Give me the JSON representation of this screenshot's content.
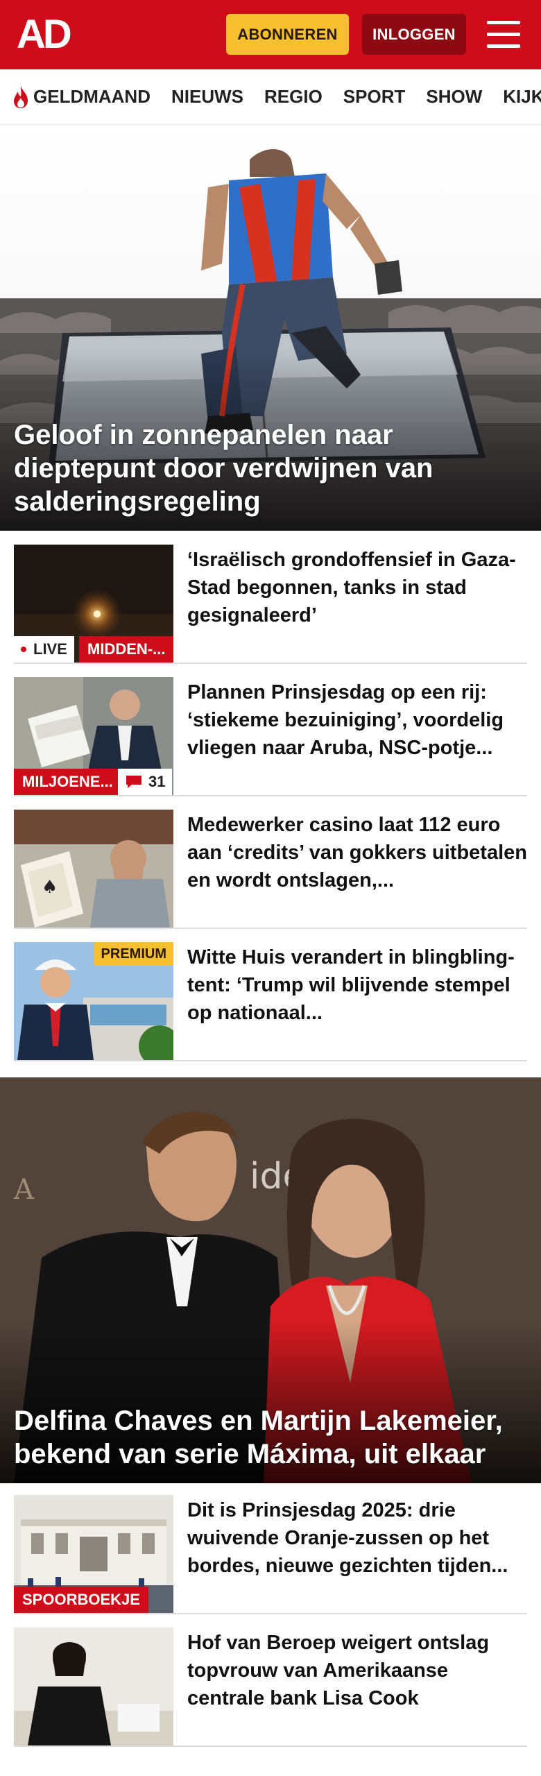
{
  "header": {
    "logo_text": "AD",
    "subscribe_label": "ABONNEREN",
    "login_label": "INLOGGEN",
    "brand_color": "#cf0d1a",
    "accent_color": "#f6c030"
  },
  "nav": {
    "items": [
      "GELDMAAND",
      "NIEUWS",
      "REGIO",
      "SPORT",
      "SHOW",
      "KIJK"
    ],
    "first_item_icon": "flame-icon"
  },
  "hero_top": {
    "headline": "Geloof in zonnepanelen naar dieptepunt door verdwijnen van salderingsregeling",
    "image": "roofer-installing-solar-panels"
  },
  "articles_a": [
    {
      "headline": "‘Israëlisch grondoffensief in Gaza-Stad begonnen, tanks in stad gesignaleerd’",
      "live_label": "LIVE",
      "tag": "MIDDEN-...",
      "image": "night-explosion"
    },
    {
      "headline": "Plannen Prinsjesdag op een rij: ‘stiekeme bezuiniging’, voordelig vliegen naar Aruba, NSC-potje...",
      "tag": "MILJOENE...",
      "comments": "31",
      "image": "minister-with-documents"
    },
    {
      "headline": "Medewerker casino laat 112 euro aan ‘credits’ van gokkers uitbetalen en wordt ontslagen,...",
      "image": "casino-cards-man"
    },
    {
      "headline": "Witte Huis verandert in blingbling-tent: ‘Trump wil blijvende stempel op nationaal...",
      "premium_label": "PREMIUM",
      "image": "trump-hard-hat"
    }
  ],
  "hero_mid": {
    "headline": "Delfina Chaves en Martijn Lakemeier, bekend van serie Máxima, uit elkaar",
    "image": "couple-red-carpet"
  },
  "articles_b": [
    {
      "headline": "Dit is Prinsjesdag 2025: drie wuivende Oranje-zussen op het bordes, nieuwe gezichten tijden...",
      "tag": "SPOORBOEKJE",
      "image": "palace-balcony"
    },
    {
      "headline": "Hof van Beroep weigert ontslag topvrouw van Amerikaanse centrale bank Lisa Cook",
      "image": "woman-at-hearing"
    }
  ]
}
